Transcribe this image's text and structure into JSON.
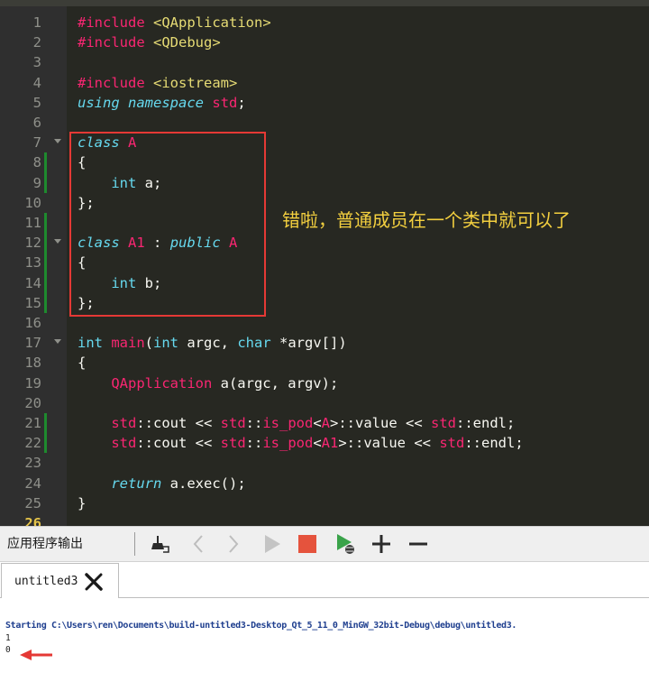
{
  "editor": {
    "lines": [
      {
        "n": "1",
        "tokens": [
          {
            "c": "kw-pre",
            "t": "#include"
          },
          {
            "c": "pl",
            "t": " "
          },
          {
            "c": "str",
            "t": "<QApplication>"
          }
        ]
      },
      {
        "n": "2",
        "tokens": [
          {
            "c": "kw-pre",
            "t": "#include"
          },
          {
            "c": "pl",
            "t": " "
          },
          {
            "c": "str",
            "t": "<QDebug>"
          }
        ]
      },
      {
        "n": "3",
        "tokens": []
      },
      {
        "n": "4",
        "tokens": [
          {
            "c": "kw-pre",
            "t": "#include"
          },
          {
            "c": "pl",
            "t": " "
          },
          {
            "c": "str",
            "t": "<iostream>"
          }
        ]
      },
      {
        "n": "5",
        "tokens": [
          {
            "c": "kw-i",
            "t": "using"
          },
          {
            "c": "pl",
            "t": " "
          },
          {
            "c": "kw-i",
            "t": "namespace"
          },
          {
            "c": "pl",
            "t": " "
          },
          {
            "c": "cls",
            "t": "std"
          },
          {
            "c": "pl",
            "t": ";"
          }
        ]
      },
      {
        "n": "6",
        "tokens": []
      },
      {
        "n": "7",
        "fold": true,
        "tokens": [
          {
            "c": "kw-i",
            "t": "class"
          },
          {
            "c": "pl",
            "t": " "
          },
          {
            "c": "cls",
            "t": "A"
          }
        ]
      },
      {
        "n": "8",
        "marker": true,
        "tokens": [
          {
            "c": "pl",
            "t": "{"
          }
        ]
      },
      {
        "n": "9",
        "marker": true,
        "tokens": [
          {
            "c": "pl",
            "t": "    "
          },
          {
            "c": "type",
            "t": "int"
          },
          {
            "c": "pl",
            "t": " a;"
          }
        ]
      },
      {
        "n": "10",
        "tokens": [
          {
            "c": "pl",
            "t": "};"
          }
        ]
      },
      {
        "n": "11",
        "marker": true,
        "tokens": []
      },
      {
        "n": "12",
        "fold": true,
        "marker": true,
        "tokens": [
          {
            "c": "kw-i",
            "t": "class"
          },
          {
            "c": "pl",
            "t": " "
          },
          {
            "c": "cls",
            "t": "A1"
          },
          {
            "c": "pl",
            "t": " : "
          },
          {
            "c": "kw-i",
            "t": "public"
          },
          {
            "c": "pl",
            "t": " "
          },
          {
            "c": "cls",
            "t": "A"
          }
        ]
      },
      {
        "n": "13",
        "marker": true,
        "tokens": [
          {
            "c": "pl",
            "t": "{"
          }
        ]
      },
      {
        "n": "14",
        "marker": true,
        "tokens": [
          {
            "c": "pl",
            "t": "    "
          },
          {
            "c": "type",
            "t": "int"
          },
          {
            "c": "pl",
            "t": " b;"
          }
        ]
      },
      {
        "n": "15",
        "marker": true,
        "tokens": [
          {
            "c": "pl",
            "t": "};"
          }
        ]
      },
      {
        "n": "16",
        "tokens": []
      },
      {
        "n": "17",
        "fold": true,
        "tokens": [
          {
            "c": "type",
            "t": "int"
          },
          {
            "c": "pl",
            "t": " "
          },
          {
            "c": "fn",
            "t": "main"
          },
          {
            "c": "pl",
            "t": "("
          },
          {
            "c": "type",
            "t": "int"
          },
          {
            "c": "pl",
            "t": " argc, "
          },
          {
            "c": "type",
            "t": "char"
          },
          {
            "c": "pl",
            "t": " *argv[])"
          }
        ]
      },
      {
        "n": "18",
        "tokens": [
          {
            "c": "pl",
            "t": "{"
          }
        ]
      },
      {
        "n": "19",
        "tokens": [
          {
            "c": "pl",
            "t": "    "
          },
          {
            "c": "cls",
            "t": "QApplication"
          },
          {
            "c": "pl",
            "t": " a(argc, argv);"
          }
        ]
      },
      {
        "n": "20",
        "tokens": []
      },
      {
        "n": "21",
        "marker": true,
        "tokens": [
          {
            "c": "pl",
            "t": "    "
          },
          {
            "c": "cls",
            "t": "std"
          },
          {
            "c": "pl",
            "t": "::cout << "
          },
          {
            "c": "cls",
            "t": "std"
          },
          {
            "c": "pl",
            "t": "::"
          },
          {
            "c": "cls",
            "t": "is_pod"
          },
          {
            "c": "pl",
            "t": "<"
          },
          {
            "c": "cls",
            "t": "A"
          },
          {
            "c": "pl",
            "t": ">::value << "
          },
          {
            "c": "cls",
            "t": "std"
          },
          {
            "c": "pl",
            "t": "::endl;"
          }
        ]
      },
      {
        "n": "22",
        "marker": true,
        "tokens": [
          {
            "c": "pl",
            "t": "    "
          },
          {
            "c": "cls",
            "t": "std"
          },
          {
            "c": "pl",
            "t": "::cout << "
          },
          {
            "c": "cls",
            "t": "std"
          },
          {
            "c": "pl",
            "t": "::"
          },
          {
            "c": "cls",
            "t": "is_pod"
          },
          {
            "c": "pl",
            "t": "<"
          },
          {
            "c": "cls",
            "t": "A1"
          },
          {
            "c": "pl",
            "t": ">::value << "
          },
          {
            "c": "cls",
            "t": "std"
          },
          {
            "c": "pl",
            "t": "::endl;"
          }
        ]
      },
      {
        "n": "23",
        "tokens": []
      },
      {
        "n": "24",
        "tokens": [
          {
            "c": "pl",
            "t": "    "
          },
          {
            "c": "kw-i",
            "t": "return"
          },
          {
            "c": "pl",
            "t": " a.exec();"
          }
        ]
      },
      {
        "n": "25",
        "tokens": [
          {
            "c": "pl",
            "t": "}"
          }
        ]
      },
      {
        "n": "26",
        "partial": true,
        "tokens": []
      }
    ],
    "annotation_text": "错啦，普通成员在一个类中就可以了"
  },
  "output_panel": {
    "title": "应用程序输出",
    "icons": [
      "clean-output-icon",
      "previous-icon",
      "next-icon",
      "run-icon",
      "stop-icon",
      "debug-run-icon",
      "zoom-in-icon",
      "zoom-out-icon"
    ],
    "tab_label": "untitled3",
    "starting_line": "Starting C:\\Users\\ren\\Documents\\build-untitled3-Desktop_Qt_5_11_0_MinGW_32bit-Debug\\debug\\untitled3.",
    "result_line_1": "1",
    "result_line_2": "0"
  },
  "colors": {
    "editor_bg": "#272822",
    "annotation_box": "#e53935",
    "annotation_text": "#f4d03f",
    "output_start_text": "#1f3f8f",
    "arrow": "#e53935",
    "stop_red": "#e5533d",
    "run_green": "#3aa34a"
  }
}
